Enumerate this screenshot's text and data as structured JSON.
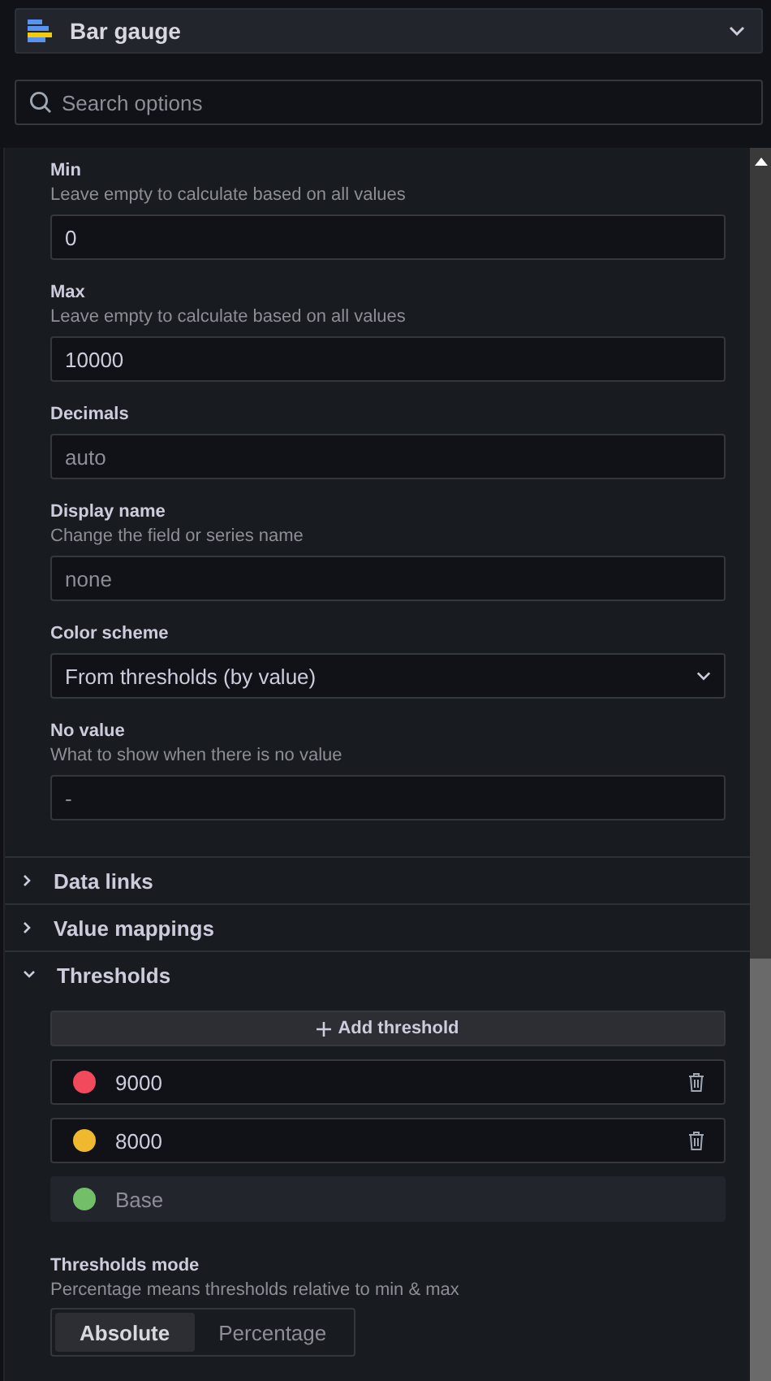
{
  "visualization": {
    "name": "Bar gauge"
  },
  "search": {
    "placeholder": "Search options"
  },
  "fields": [
    {
      "kind": "input",
      "label": "Min",
      "description": "Leave empty to calculate based on all values",
      "value": "0"
    },
    {
      "kind": "input",
      "label": "Max",
      "description": "Leave empty to calculate based on all values",
      "value": "10000"
    },
    {
      "kind": "input",
      "label": "Decimals",
      "placeholder": "auto"
    },
    {
      "kind": "input",
      "label": "Display name",
      "description": "Change the field or series name",
      "placeholder": "none"
    },
    {
      "kind": "select",
      "label": "Color scheme",
      "value": "From thresholds (by value)"
    },
    {
      "kind": "input",
      "label": "No value",
      "description": "What to show when there is no value",
      "placeholder": "-"
    }
  ],
  "sections": [
    {
      "title": "Data links",
      "expanded": false
    },
    {
      "title": "Value mappings",
      "expanded": false
    },
    {
      "title": "Thresholds",
      "expanded": true
    }
  ],
  "thresholds": {
    "add_label": "Add threshold",
    "steps": [
      {
        "kind": "step",
        "value": "9000",
        "color": "#f2495c"
      },
      {
        "kind": "step",
        "value": "8000",
        "color": "#f0b82e"
      },
      {
        "kind": "base",
        "value": "Base",
        "color": "#73bf69"
      }
    ],
    "mode": {
      "label": "Thresholds mode",
      "description": "Percentage means thresholds relative to min & max",
      "options": [
        {
          "label": "Absolute",
          "selected": true
        },
        {
          "label": "Percentage",
          "selected": false
        }
      ]
    }
  }
}
